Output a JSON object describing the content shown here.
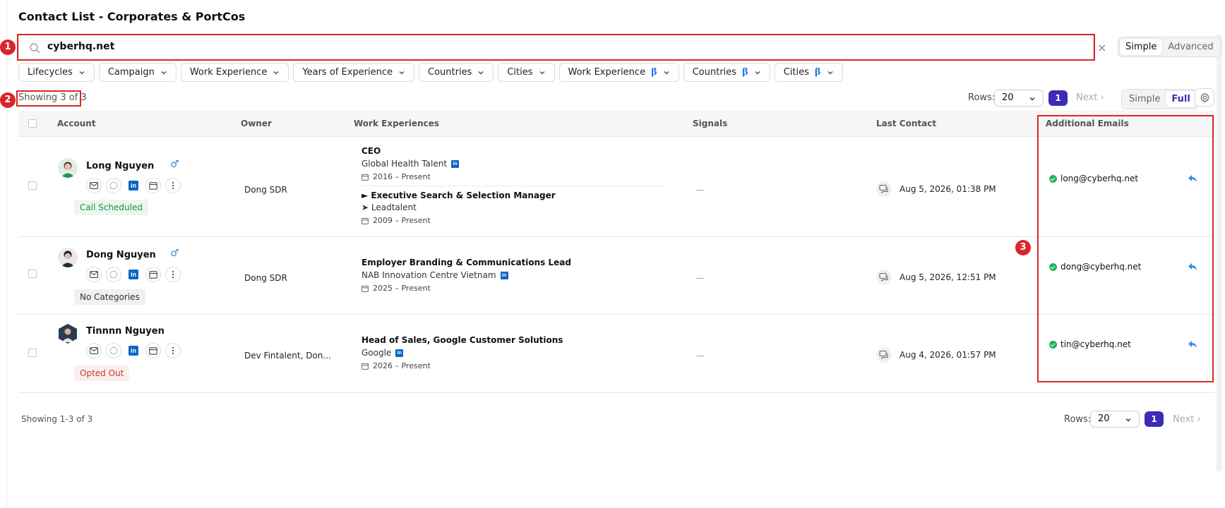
{
  "page": {
    "title": "Contact List - Corporates & PortCos"
  },
  "search": {
    "value": "cyberhq.net",
    "clear": "×"
  },
  "search_mode": {
    "simple": "Simple",
    "advanced": "Advanced"
  },
  "filters": [
    {
      "label": "Lifecycles",
      "beta": ""
    },
    {
      "label": "Campaign",
      "beta": ""
    },
    {
      "label": "Work Experience",
      "beta": ""
    },
    {
      "label": "Years of Experience",
      "beta": ""
    },
    {
      "label": "Countries",
      "beta": ""
    },
    {
      "label": "Cities",
      "beta": ""
    },
    {
      "label": "Work Experience",
      "beta": "β"
    },
    {
      "label": "Countries",
      "beta": "β"
    },
    {
      "label": "Cities",
      "beta": "β"
    }
  ],
  "summary": {
    "showing_top": "Showing 3 of 3",
    "showing_bottom": "Showing 1-3 of 3"
  },
  "pagination": {
    "rows_label": "Rows:",
    "rows_value": "20",
    "page": "1",
    "next": "Next"
  },
  "view_mode": {
    "simple": "Simple",
    "full": "Full"
  },
  "columns": {
    "account": "Account",
    "owner": "Owner",
    "work": "Work Experiences",
    "signals": "Signals",
    "last_contact": "Last Contact",
    "emails": "Additional Emails"
  },
  "rows": [
    {
      "name": "Long Nguyen",
      "gender": "♂",
      "tag": "Call Scheduled",
      "owner": "Dong SDR",
      "experiences": [
        {
          "title": "CEO",
          "company": "Global Health Talent",
          "dates": "2016 – Present"
        },
        {
          "title": "► Executive Search & Selection Manager",
          "company": "➤ Leadtalent",
          "dates": "2009 – Present"
        }
      ],
      "signals": "—",
      "last_contact": "Aug 5, 2026, 01:38 PM",
      "email": "long@cyberhq.net"
    },
    {
      "name": "Dong Nguyen",
      "gender": "♂",
      "tag": "No Categories",
      "owner": "Dong SDR",
      "experiences": [
        {
          "title": "Employer Branding & Communications Lead",
          "company": "NAB Innovation Centre Vietnam",
          "dates": "2025 – Present"
        }
      ],
      "signals": "—",
      "last_contact": "Aug 5, 2026, 12:51 PM",
      "email": "dong@cyberhq.net"
    },
    {
      "name": "Tinnnn Nguyen",
      "gender": "",
      "tag": "Opted Out",
      "owner": "Dev Fintalent, Don...",
      "experiences": [
        {
          "title": "Head of Sales, Google Customer Solutions",
          "company": "Google",
          "dates": "2026 – Present"
        }
      ],
      "signals": "—",
      "last_contact": "Aug 4, 2026, 01:57 PM",
      "email": "tin@cyberhq.net"
    }
  ],
  "annotations": [
    "1",
    "2",
    "3"
  ],
  "colors": {
    "accent": "#3b2db5",
    "annotation": "#d9262a",
    "linkedin": "#0a66c2",
    "success": "#22b35a"
  }
}
